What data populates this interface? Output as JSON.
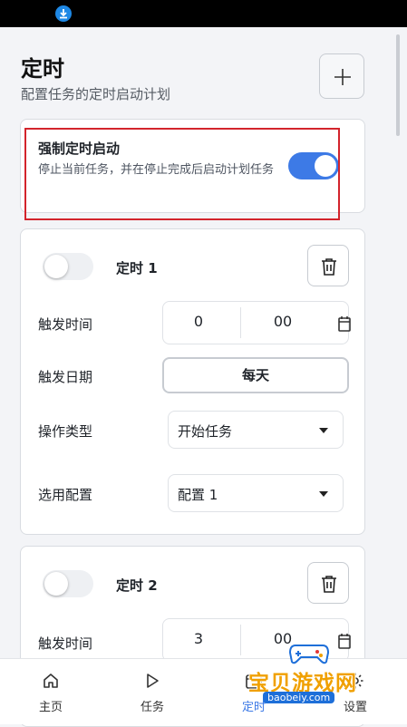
{
  "page": {
    "title": "定时",
    "subtitle": "配置任务的定时启动计划"
  },
  "force_start": {
    "title": "强制定时启动",
    "description": "停止当前任务，并在停止完成后启动计划任务",
    "enabled": true
  },
  "labels": {
    "trigger_time": "触发时间",
    "trigger_date": "触发日期",
    "operation_type": "操作类型",
    "selected_config": "选用配置"
  },
  "timers": [
    {
      "name": "定时 1",
      "enabled": false,
      "hour": "0",
      "minute": "00",
      "date": "每天",
      "operation": "开始任务",
      "config": "配置 1"
    },
    {
      "name": "定时 2",
      "enabled": false,
      "hour": "3",
      "minute": "00"
    }
  ],
  "nav": [
    {
      "label": "主页",
      "icon": "home-icon"
    },
    {
      "label": "任务",
      "icon": "play-icon"
    },
    {
      "label": "定时",
      "icon": "calendar-icon",
      "active": true
    },
    {
      "label": "设置",
      "icon": "settings-icon"
    }
  ],
  "watermark": {
    "text": "宝贝游戏网",
    "url": "baobeiy.com"
  },
  "colors": {
    "accent": "#3d7ae6",
    "highlight_border": "#d3242c"
  }
}
